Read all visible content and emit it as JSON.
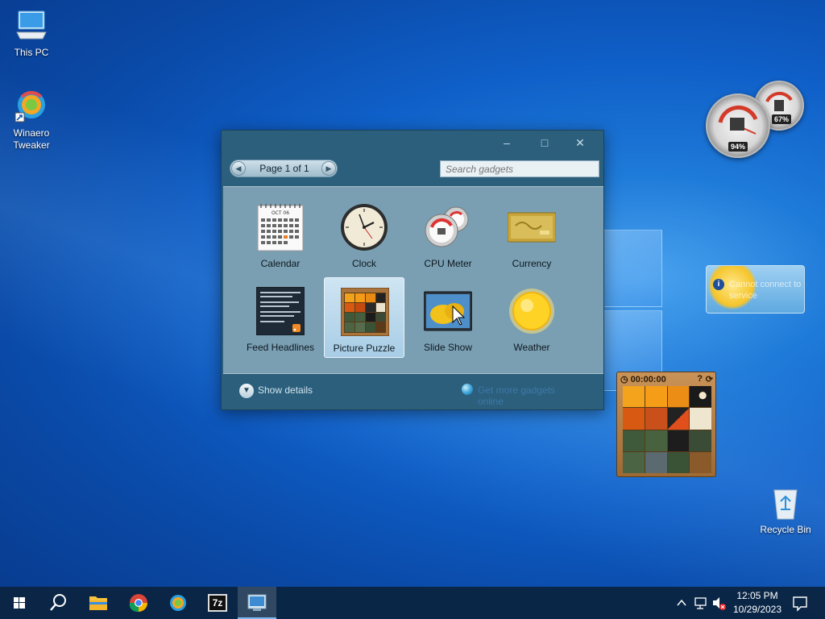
{
  "desktop": {
    "icons": [
      {
        "label": "This PC",
        "icon": "this-pc-icon"
      },
      {
        "label": "Winaero Tweaker",
        "icon": "winaero-tweaker-icon"
      },
      {
        "label": "Recycle Bin",
        "icon": "recycle-bin-icon"
      }
    ]
  },
  "gallery": {
    "pager_text": "Page 1 of 1",
    "search_placeholder": "Search gadgets",
    "gadgets": [
      {
        "label": "Calendar",
        "icon": "calendar-icon"
      },
      {
        "label": "Clock",
        "icon": "clock-icon"
      },
      {
        "label": "CPU Meter",
        "icon": "cpu-meter-icon"
      },
      {
        "label": "Currency",
        "icon": "currency-icon"
      },
      {
        "label": "Feed Headlines",
        "icon": "feed-headlines-icon"
      },
      {
        "label": "Picture Puzzle",
        "icon": "picture-puzzle-icon",
        "selected": true
      },
      {
        "label": "Slide Show",
        "icon": "slide-show-icon"
      },
      {
        "label": "Weather",
        "icon": "weather-icon"
      }
    ],
    "calendar_month": "OCT 06",
    "show_details": "Show details",
    "online_link": "Get more gadgets online"
  },
  "cpu_meter": {
    "cpu_percent": "94%",
    "memory_percent": "67%"
  },
  "weather_gadget": {
    "message": "Cannot connect to service"
  },
  "puzzle_gadget": {
    "timer": "00:00:00"
  },
  "taskbar": {
    "pinned": [
      "start-icon",
      "search-icon",
      "file-explorer-icon",
      "chrome-icon",
      "winaero-tweaker-icon",
      "7zip-icon",
      "gadgets-icon"
    ],
    "sevenzip_label": "7z",
    "time": "12:05 PM",
    "date": "10/29/2023"
  }
}
